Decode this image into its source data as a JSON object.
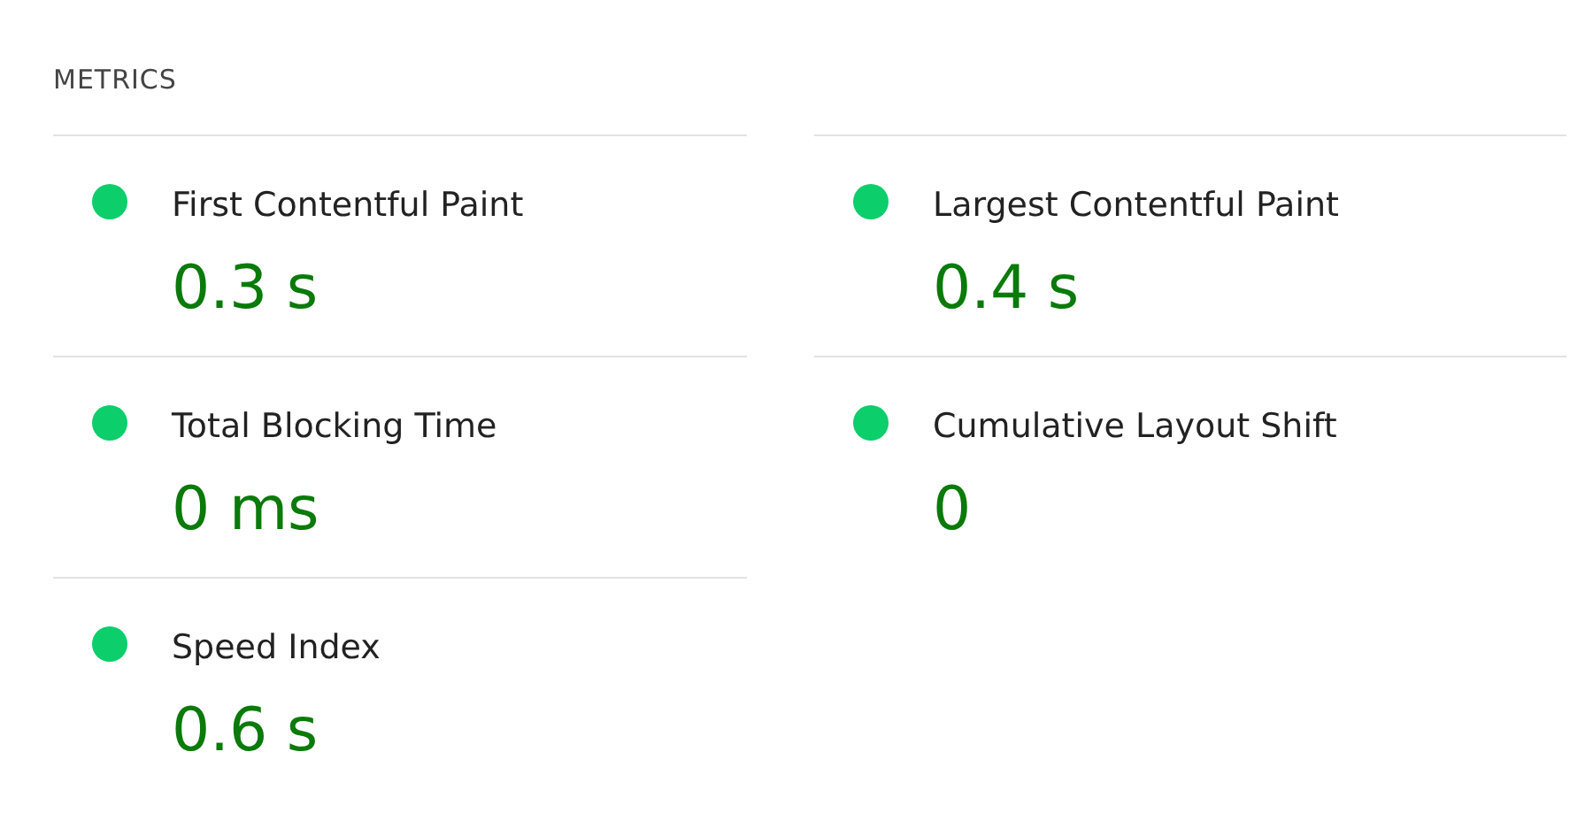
{
  "section_title": "METRICS",
  "metrics": [
    {
      "label": "First Contentful Paint",
      "value": "0.3 s",
      "color": "#0cce6b"
    },
    {
      "label": "Largest Contentful Paint",
      "value": "0.4 s",
      "color": "#0cce6b"
    },
    {
      "label": "Total Blocking Time",
      "value": "0 ms",
      "color": "#0cce6b"
    },
    {
      "label": "Cumulative Layout Shift",
      "value": "0",
      "color": "#0cce6b"
    },
    {
      "label": "Speed Index",
      "value": "0.6 s",
      "color": "#0cce6b"
    }
  ]
}
